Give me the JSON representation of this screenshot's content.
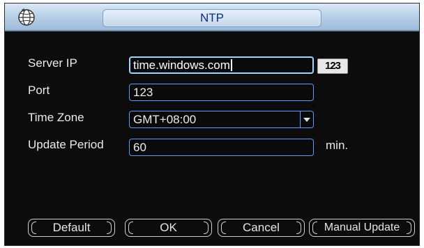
{
  "window": {
    "title": "NTP",
    "app_icon": "globe-icon"
  },
  "form": {
    "server_ip": {
      "label": "Server IP",
      "value": "time.windows.com"
    },
    "keyboard_button": {
      "label": "123",
      "icon": "keyboard-icon"
    },
    "port": {
      "label": "Port",
      "value": "123"
    },
    "time_zone": {
      "label": "Time Zone",
      "value": "GMT+08:00",
      "icon": "chevron-down-icon"
    },
    "update_period": {
      "label": "Update Period",
      "value": "60",
      "unit": "min."
    }
  },
  "buttons": {
    "default": "Default",
    "ok": "OK",
    "cancel": "Cancel",
    "manual_update": "Manual Update"
  },
  "colors": {
    "title_text": "#0a2a9a",
    "field_border": "#4aa0ff",
    "background": "#0c0c0c"
  }
}
